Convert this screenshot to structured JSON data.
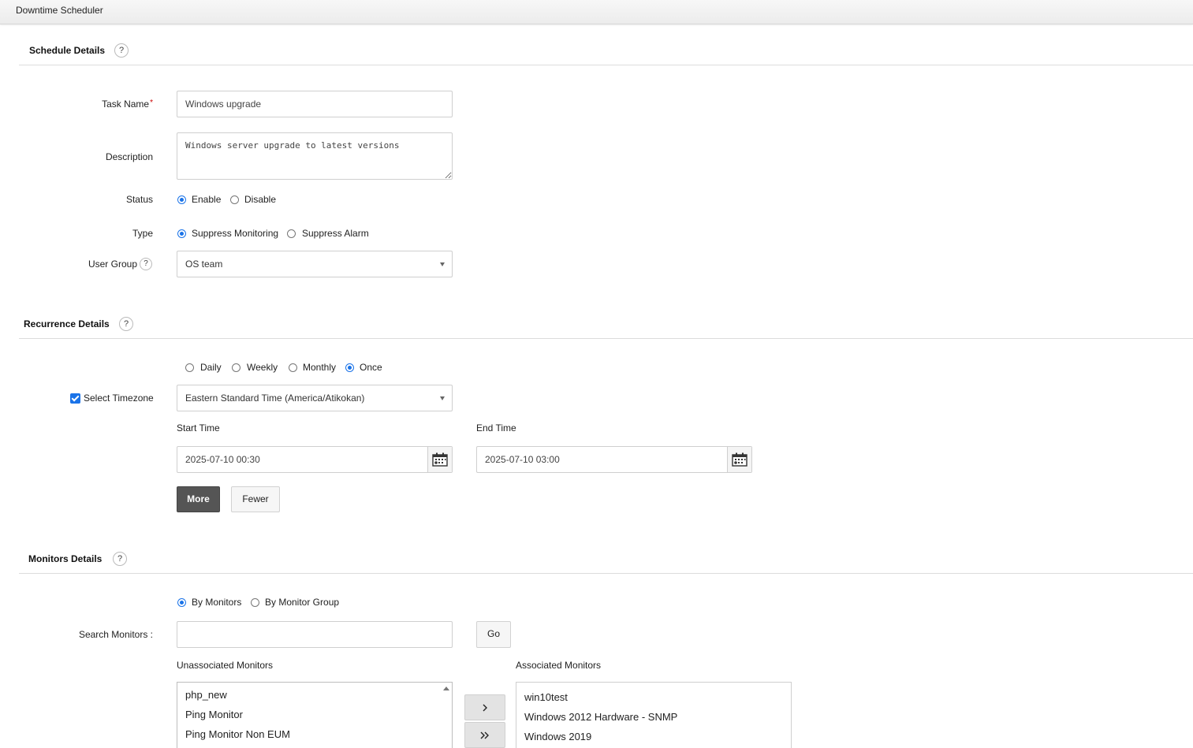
{
  "window": {
    "title": "Downtime Scheduler"
  },
  "schedule": {
    "title": "Schedule Details",
    "help": "?",
    "task_name_label": "Task Name",
    "required_mark": "*",
    "task_name_value": "Windows upgrade",
    "description_label": "Description",
    "description_value": "Windows server upgrade to latest versions",
    "status_label": "Status",
    "status_options": [
      "Enable",
      "Disable"
    ],
    "status_selected": "Enable",
    "type_label": "Type",
    "type_options": [
      "Suppress Monitoring",
      "Suppress Alarm"
    ],
    "type_selected": "Suppress Monitoring",
    "user_group_label": "User Group",
    "user_group_help": "?",
    "user_group_value": "OS team"
  },
  "recurrence": {
    "title": "Recurrence Details",
    "help": "?",
    "options": [
      "Daily",
      "Weekly",
      "Monthly",
      "Once"
    ],
    "selected": "Once",
    "timezone_checkbox_label": "Select Timezone",
    "timezone_checked": true,
    "timezone_value": "Eastern Standard Time (America/Atikokan)",
    "start_label": "Start Time",
    "start_value": "2025-07-10 00:30",
    "end_label": "End Time",
    "end_value": "2025-07-10 03:00",
    "more_label": "More",
    "fewer_label": "Fewer"
  },
  "monitors": {
    "title": "Monitors Details",
    "help": "?",
    "options": [
      "By Monitors",
      "By Monitor Group"
    ],
    "selected": "By Monitors",
    "search_label": "Search Monitors :",
    "search_value": "",
    "go_label": "Go",
    "unassociated_label": "Unassociated Monitors",
    "unassociated": [
      "php_new",
      "Ping Monitor",
      "Ping Monitor Non EUM"
    ],
    "associated_label": "Associated Monitors",
    "associated": [
      "win10test",
      "Windows 2012 Hardware - SNMP",
      "Windows 2019"
    ]
  },
  "colors": {
    "accent": "#1a73e8",
    "dark_button": "#555555"
  },
  "icons": {
    "calendar": "calendar-icon",
    "move_one": "chevron-right-icon",
    "move_all": "double-chevron-right-icon"
  }
}
